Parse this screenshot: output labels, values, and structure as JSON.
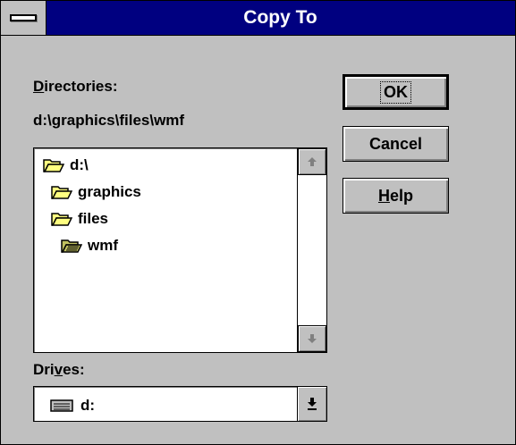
{
  "window": {
    "title": "Copy To"
  },
  "labels": {
    "directories_pre": "",
    "directories_mnemonic": "D",
    "directories_post": "irectories:",
    "current_path": "d:\\graphics\\files\\wmf",
    "drives_pre": "Dri",
    "drives_mnemonic": "v",
    "drives_post": "es:"
  },
  "directory_list": {
    "items": [
      {
        "label": "d:\\",
        "icon": "folder-open-icon"
      },
      {
        "label": "graphics",
        "icon": "folder-open-icon"
      },
      {
        "label": "files",
        "icon": "folder-open-icon"
      },
      {
        "label": "wmf",
        "icon": "folder-open-selected-icon"
      }
    ]
  },
  "drives": {
    "selected": "d:",
    "icon": "drive-icon"
  },
  "buttons": {
    "ok": "OK",
    "cancel": "Cancel",
    "help_mnemonic": "H",
    "help_post": "elp"
  },
  "colors": {
    "titlebar": "#000080",
    "face": "#c0c0c0",
    "folder": "#ffff80"
  }
}
